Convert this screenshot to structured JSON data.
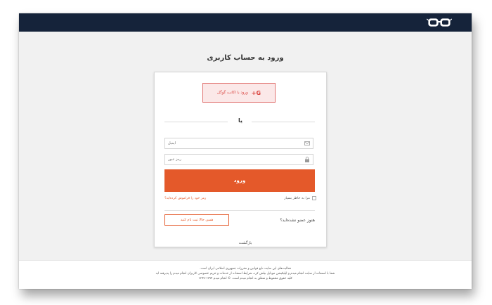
{
  "logo": {
    "name": "glasses-logo"
  },
  "page": {
    "title": "ورود به حساب کاربری"
  },
  "google": {
    "label": "ورود با اکانت گوگل",
    "icon_text": "G+"
  },
  "divider": {
    "or": "یا"
  },
  "email": {
    "placeholder": "ایمیل",
    "icon": "envelope-icon"
  },
  "password": {
    "placeholder": "رمز عبور",
    "icon": "lock-icon"
  },
  "login_button": {
    "label": "ورود"
  },
  "remember": {
    "label": "مرا به خاطر بسپار"
  },
  "forgot": {
    "label": "رمز خود را فراموش کرده‌اید؟"
  },
  "signup": {
    "question": "هنوز عضو نشده‌اید؟",
    "button": "همین حالا ثبت نام کنید"
  },
  "back": {
    "label": "بازگشت"
  },
  "footer": {
    "line1": "فعالیت‌های این سایت تابع قوانین و مقررات جمهوری اسلامی ایران است.",
    "line2": "شما با استفاده از سایت انجام میدم و اپلیکیشن موبایل بیلش کرد، شرایط استفاده از خدمات و حریم خصوصی کاربران انجام میدم را پذیرفته اید",
    "line3": "کلیه حقوق محفوظ و متعلق به انجام میدم است.  © انجام میدم ۱۳۹۴-۱۳۹۷"
  },
  "colors": {
    "topbar": "#15233a",
    "accent": "#e4592a",
    "google": "#d9413c"
  }
}
